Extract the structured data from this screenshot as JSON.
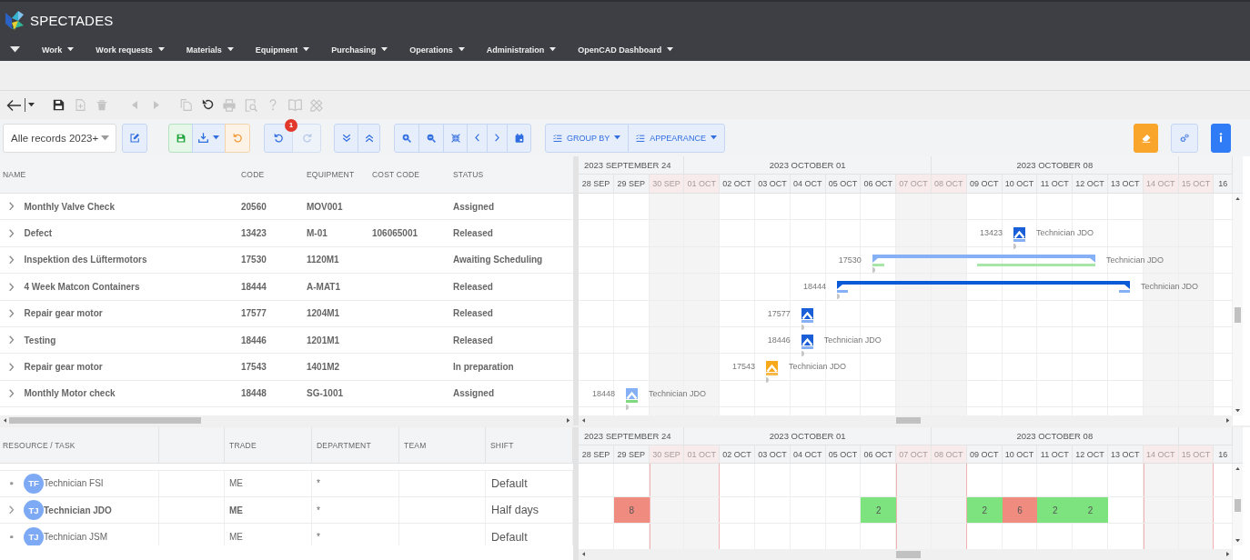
{
  "app": {
    "name": "SPECTADES"
  },
  "nav": {
    "items": [
      {
        "label": "Work"
      },
      {
        "label": "Work requests"
      },
      {
        "label": "Materials"
      },
      {
        "label": "Equipment"
      },
      {
        "label": "Purchasing"
      },
      {
        "label": "Operations"
      },
      {
        "label": "Administration"
      },
      {
        "label": "OpenCAD Dashboard"
      }
    ]
  },
  "toolbar": {
    "groups": [
      {
        "tools": [
          {
            "kind": "back",
            "disabled": false
          },
          {
            "kind": "history",
            "disabled": false
          }
        ]
      },
      {
        "tools": [
          {
            "kind": "save",
            "disabled": false
          },
          {
            "kind": "new",
            "disabled": true
          },
          {
            "kind": "delete",
            "disabled": true
          }
        ]
      },
      {
        "tools": [
          {
            "kind": "previous",
            "disabled": true
          },
          {
            "kind": "next",
            "disabled": true
          }
        ]
      },
      {
        "tools": [
          {
            "kind": "copy",
            "disabled": true
          },
          {
            "kind": "refresh",
            "disabled": false
          },
          {
            "kind": "print",
            "disabled": true
          },
          {
            "kind": "preview",
            "disabled": true
          },
          {
            "kind": "help",
            "disabled": true
          },
          {
            "kind": "manual",
            "disabled": true
          },
          {
            "kind": "tools",
            "disabled": true
          }
        ]
      }
    ]
  },
  "view_filter": {
    "value": "Alle records 2023+"
  },
  "actions": {
    "left": [
      {
        "buttons": [
          {
            "kind": "edit",
            "disabled": false
          }
        ]
      },
      {
        "buttons": [
          {
            "kind": "save",
            "disabled": false
          },
          {
            "kind": "export",
            "disabled": false
          },
          {
            "kind": "revert",
            "disabled": false
          }
        ]
      },
      {
        "buttons": [
          {
            "kind": "undo",
            "disabled": false,
            "badge": "1"
          },
          {
            "kind": "redo",
            "disabled": true
          }
        ]
      },
      {
        "buttons": [
          {
            "kind": "expand-all",
            "disabled": false
          },
          {
            "kind": "collapse-all",
            "disabled": false
          }
        ]
      },
      {
        "buttons": [
          {
            "kind": "zoom-in",
            "disabled": false
          },
          {
            "kind": "zoom-out",
            "disabled": false
          },
          {
            "kind": "fit",
            "disabled": false
          },
          {
            "kind": "previous-period",
            "disabled": false
          },
          {
            "kind": "next-period",
            "disabled": false
          },
          {
            "kind": "today",
            "disabled": false
          }
        ]
      },
      {
        "buttons": [
          {
            "kind": "group-by",
            "disabled": false,
            "label": "GROUP BY"
          },
          {
            "kind": "appearance",
            "disabled": false,
            "label": "APPEARANCE"
          }
        ]
      }
    ],
    "right": [
      {
        "buttons": [
          {
            "kind": "clear",
            "disabled": false
          }
        ]
      },
      {
        "buttons": [
          {
            "kind": "settings",
            "disabled": false
          }
        ]
      },
      {
        "buttons": [
          {
            "kind": "info",
            "disabled": false
          }
        ]
      }
    ]
  },
  "tasks": {
    "columns": [
      "NAME",
      "CODE",
      "EQUIPMENT",
      "COST CODE",
      "STATUS"
    ],
    "rows": [
      {
        "name": "Monthly Valve Check",
        "code": "20560",
        "equipment": "MOV001",
        "status": "Assigned",
        "expanded": false
      },
      {
        "name": "Defect",
        "code": "13423",
        "equipment": "M-01",
        "cost_code": "106065001",
        "status": "Released",
        "expanded": false,
        "timeline": {
          "kind": "milestone",
          "code": "13423",
          "color": "#1a5fd8",
          "baselines": [
            {
              "color": "#86b0f5"
            }
          ],
          "assignee": "Technician JDO"
        }
      },
      {
        "name": "Inspektion des Lüftermotors",
        "code": "17530",
        "equipment": "1120M1",
        "status": "Awaiting Scheduling",
        "expanded": false,
        "timeline": {
          "kind": "summary",
          "code": "17530",
          "color": "#86b0f5",
          "baselines": [
            {
              "color": "#a8e5a8"
            },
            {
              "color": "#a8e5a8"
            }
          ],
          "assignee": "Technician JDO"
        }
      },
      {
        "name": "4 Week Matcon Containers",
        "code": "18444",
        "equipment": "A-MAT1",
        "status": "Released",
        "expanded": false,
        "timeline": {
          "kind": "summary",
          "code": "18444",
          "color": "#0b5bd9",
          "baselines": [
            {
              "color": "#86b0f5"
            },
            {
              "color": "#86b0f5"
            }
          ],
          "assignee": "Technician JDO"
        }
      },
      {
        "name": "Repair gear motor",
        "code": "17577",
        "equipment": "1204M1",
        "status": "Released",
        "expanded": false,
        "timeline": {
          "kind": "milestone",
          "code": "17577",
          "color": "#1a5fd8",
          "baselines": [
            {
              "color": "#86b0f5"
            }
          ]
        }
      },
      {
        "name": "Testing",
        "code": "18446",
        "equipment": "1201M1",
        "status": "Released",
        "expanded": false,
        "timeline": {
          "kind": "milestone",
          "code": "18446",
          "color": "#1a5fd8",
          "baselines": [
            {
              "color": "#86b0f5"
            }
          ],
          "assignee": "Technician JDO"
        }
      },
      {
        "name": "Repair gear motor",
        "code": "17543",
        "equipment": "1401M2",
        "status": "In preparation",
        "expanded": false,
        "timeline": {
          "kind": "milestone",
          "code": "17543",
          "color": "#f7a81b",
          "baselines": [
            {
              "color": "#f7b84a"
            }
          ],
          "assignee": "Technician JDO"
        }
      },
      {
        "name": "Monthly Motor check",
        "code": "18448",
        "equipment": "SG-1001",
        "status": "Assigned",
        "expanded": false,
        "timeline": {
          "kind": "milestone",
          "code": "18448",
          "color": "#86b0f5",
          "baselines": [
            {
              "color": "#7fd97f"
            }
          ],
          "assignee": "Technician JDO"
        }
      }
    ]
  },
  "task_gantt": {
    "weeks": [
      {
        "label": "2023 SEPTEMBER 24",
        "days": [
          {
            "label": "28 SEP",
            "weekend": false
          },
          {
            "label": "29 SEP",
            "weekend": false
          },
          {
            "label": "30 SEP",
            "weekend": true
          }
        ]
      },
      {
        "label": "2023 OCTOBER 01",
        "days": [
          {
            "label": "01 OCT",
            "weekend": true
          },
          {
            "label": "02 OCT",
            "weekend": false
          },
          {
            "label": "03 OCT",
            "weekend": false
          },
          {
            "label": "04 OCT",
            "weekend": false
          },
          {
            "label": "05 OCT",
            "weekend": false
          },
          {
            "label": "06 OCT",
            "weekend": false
          },
          {
            "label": "07 OCT",
            "weekend": true
          }
        ]
      },
      {
        "label": "2023 OCTOBER 08",
        "days": [
          {
            "label": "08 OCT",
            "weekend": true
          },
          {
            "label": "09 OCT",
            "weekend": false
          },
          {
            "label": "10 OCT",
            "weekend": false
          },
          {
            "label": "11 OCT",
            "weekend": false
          },
          {
            "label": "12 OCT",
            "weekend": false
          },
          {
            "label": "13 OCT",
            "weekend": false
          },
          {
            "label": "14 OCT",
            "weekend": true
          }
        ]
      },
      {
        "days": [
          {
            "label": "15 OCT",
            "weekend": true
          },
          {
            "label": "16",
            "weekend": false
          }
        ]
      }
    ]
  },
  "resources": {
    "columns": [
      "RESOURCE / TASK",
      "TRADE",
      "DEPARTMENT",
      "TEAM",
      "SHIFT"
    ],
    "rows": [
      {
        "kind": "leaf",
        "initials": "TF",
        "name": "Technician FSI",
        "trade": "ME",
        "department": "*",
        "shift": "Default"
      },
      {
        "kind": "group",
        "initials": "TJ",
        "name": "Technician JDO",
        "trade": "ME",
        "department": "*",
        "shift": "Half days",
        "load": [
          {
            "kind": "none"
          },
          {
            "kind": "over",
            "value": "8"
          },
          {
            "kind": "none"
          },
          {
            "kind": "none"
          },
          {
            "kind": "none"
          },
          {
            "kind": "none"
          },
          {
            "kind": "none"
          },
          {
            "kind": "none"
          },
          {
            "kind": "under",
            "value": "2"
          },
          {
            "kind": "none"
          },
          {
            "kind": "none"
          },
          {
            "kind": "under",
            "value": "2"
          },
          {
            "kind": "over",
            "value": "6"
          },
          {
            "kind": "under",
            "value": "2"
          },
          {
            "kind": "under",
            "value": "2"
          },
          {
            "kind": "none"
          },
          {
            "kind": "none"
          },
          {
            "kind": "none"
          },
          {
            "kind": "none"
          }
        ]
      },
      {
        "kind": "leaf",
        "initials": "TJ",
        "name": "Technician JSM",
        "trade": "ME",
        "department": "*",
        "shift": "Default"
      }
    ]
  },
  "resource_gantt": {
    "weeks": [
      {
        "label": "2023 SEPTEMBER 24",
        "days": [
          {
            "label": "28 SEP",
            "weekend": false
          },
          {
            "label": "29 SEP",
            "weekend": false
          },
          {
            "label": "30 SEP",
            "weekend": true
          }
        ]
      },
      {
        "label": "2023 OCTOBER 01",
        "days": [
          {
            "label": "01 OCT",
            "weekend": true
          },
          {
            "label": "02 OCT",
            "weekend": false
          },
          {
            "label": "03 OCT",
            "weekend": false
          },
          {
            "label": "04 OCT",
            "weekend": false
          },
          {
            "label": "05 OCT",
            "weekend": false
          },
          {
            "label": "06 OCT",
            "weekend": false
          },
          {
            "label": "07 OCT",
            "weekend": true
          }
        ]
      },
      {
        "label": "2023 OCTOBER 08",
        "days": [
          {
            "label": "08 OCT",
            "weekend": true
          },
          {
            "label": "09 OCT",
            "weekend": false
          },
          {
            "label": "10 OCT",
            "weekend": false
          },
          {
            "label": "11 OCT",
            "weekend": false
          },
          {
            "label": "12 OCT",
            "weekend": false
          },
          {
            "label": "13 OCT",
            "weekend": false
          },
          {
            "label": "14 OCT",
            "weekend": true
          }
        ]
      },
      {
        "days": [
          {
            "label": "15 OCT",
            "weekend": true
          },
          {
            "label": "16",
            "weekend": false
          }
        ]
      }
    ]
  }
}
